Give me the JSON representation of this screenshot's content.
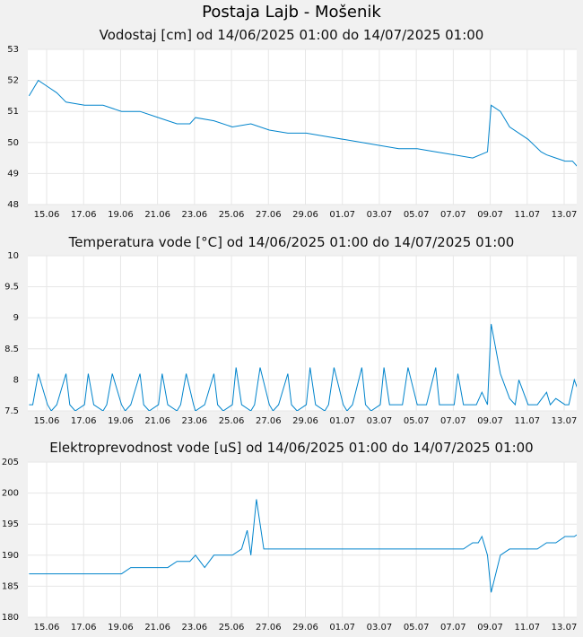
{
  "page_title": "Postaja Lajb - Mošenik",
  "line_color": "#0084cc",
  "grid_color": "#e6e6e6",
  "chart_data": [
    {
      "type": "line",
      "title": "Vodostaj [cm] od 14/06/2025 01:00 do 14/07/2025 01:00",
      "x_tick_labels": [
        "15.06",
        "17.06",
        "19.06",
        "21.06",
        "23.06",
        "25.06",
        "27.06",
        "29.06",
        "01.07",
        "03.07",
        "05.07",
        "07.07",
        "09.07",
        "11.07",
        "13.07"
      ],
      "x_range_days": [
        0,
        30
      ],
      "y_ticks": [
        48,
        49,
        50,
        51,
        52,
        53
      ],
      "ylim": [
        48,
        53
      ],
      "series": [
        {
          "x_days": [
            0.0,
            0.5,
            1.0,
            1.5,
            2.0,
            3.0,
            4.0,
            5.0,
            6.0,
            7.0,
            8.0,
            8.7,
            9.0,
            10.0,
            11.0,
            12.0,
            13.0,
            14.0,
            15.0,
            16.0,
            17.0,
            18.0,
            19.0,
            20.0,
            21.0,
            22.0,
            23.0,
            24.0,
            24.8,
            25.0,
            25.5,
            26.0,
            27.0,
            27.7,
            28.0,
            28.5,
            29.0,
            29.4,
            29.7,
            30.0
          ],
          "values": [
            51.5,
            52.0,
            51.8,
            51.6,
            51.3,
            51.2,
            51.2,
            51.0,
            51.0,
            50.8,
            50.6,
            50.6,
            50.8,
            50.7,
            50.5,
            50.6,
            50.4,
            50.3,
            50.3,
            50.2,
            50.1,
            50.0,
            49.9,
            49.8,
            49.8,
            49.7,
            49.6,
            49.5,
            49.7,
            51.2,
            51.0,
            50.5,
            50.1,
            49.7,
            49.6,
            49.5,
            49.4,
            49.4,
            49.2,
            49.0
          ]
        }
      ]
    },
    {
      "type": "line",
      "title": "Temperatura vode [°C] od 14/06/2025 01:00 do 14/07/2025 01:00",
      "x_tick_labels": [
        "15.06",
        "17.06",
        "19.06",
        "21.06",
        "23.06",
        "25.06",
        "27.06",
        "29.06",
        "01.07",
        "03.07",
        "05.07",
        "07.07",
        "09.07",
        "11.07",
        "13.07"
      ],
      "x_range_days": [
        0,
        30
      ],
      "y_ticks": [
        7.5,
        8,
        8.5,
        9,
        9.5,
        10
      ],
      "y_tick_labels": [
        "7.5",
        "8",
        "8.5",
        "9",
        "9.5",
        "10"
      ],
      "ylim": [
        7.5,
        10
      ],
      "series": [
        {
          "x_days": [
            0.0,
            0.2,
            0.5,
            1.0,
            1.2,
            1.5,
            2.0,
            2.2,
            2.5,
            3.0,
            3.2,
            3.5,
            4.0,
            4.2,
            4.5,
            5.0,
            5.2,
            5.5,
            6.0,
            6.2,
            6.5,
            7.0,
            7.2,
            7.5,
            8.0,
            8.2,
            8.5,
            8.9,
            9.0,
            9.5,
            10.0,
            10.2,
            10.5,
            11.0,
            11.2,
            11.5,
            12.0,
            12.2,
            12.5,
            13.0,
            13.2,
            13.5,
            14.0,
            14.2,
            14.5,
            15.0,
            15.2,
            15.5,
            16.0,
            16.2,
            16.5,
            17.0,
            17.2,
            17.5,
            18.0,
            18.2,
            18.5,
            19.0,
            19.2,
            19.5,
            20.0,
            20.2,
            20.5,
            21.0,
            21.2,
            21.5,
            22.0,
            22.2,
            22.5,
            23.0,
            23.2,
            23.5,
            24.0,
            24.2,
            24.5,
            24.8,
            25.0,
            25.5,
            26.0,
            26.3,
            26.5,
            27.0,
            27.2,
            27.5,
            28.0,
            28.2,
            28.5,
            29.0,
            29.2,
            29.5,
            30.0
          ],
          "values": [
            7.6,
            7.6,
            8.1,
            7.6,
            7.5,
            7.6,
            8.1,
            7.6,
            7.5,
            7.6,
            8.1,
            7.6,
            7.5,
            7.6,
            8.1,
            7.6,
            7.5,
            7.6,
            8.1,
            7.6,
            7.5,
            7.6,
            8.1,
            7.6,
            7.5,
            7.6,
            8.1,
            7.6,
            7.5,
            7.6,
            8.1,
            7.6,
            7.5,
            7.6,
            8.2,
            7.6,
            7.5,
            7.6,
            8.2,
            7.6,
            7.5,
            7.6,
            8.1,
            7.6,
            7.5,
            7.6,
            8.2,
            7.6,
            7.5,
            7.6,
            8.2,
            7.6,
            7.5,
            7.6,
            8.2,
            7.6,
            7.5,
            7.6,
            8.2,
            7.6,
            7.6,
            7.6,
            8.2,
            7.6,
            7.6,
            7.6,
            8.2,
            7.6,
            7.6,
            7.6,
            8.1,
            7.6,
            7.6,
            7.6,
            7.8,
            7.6,
            8.9,
            8.1,
            7.7,
            7.6,
            8.0,
            7.6,
            7.6,
            7.6,
            7.8,
            7.6,
            7.7,
            7.6,
            7.6,
            8.0,
            7.6
          ]
        }
      ]
    },
    {
      "type": "line",
      "title": "Elektroprevodnost vode [uS] od 14/06/2025 01:00 do 14/07/2025 01:00",
      "x_tick_labels": [
        "15.06",
        "17.06",
        "19.06",
        "21.06",
        "23.06",
        "25.06",
        "27.06",
        "29.06",
        "01.07",
        "03.07",
        "05.07",
        "07.07",
        "09.07",
        "11.07",
        "13.07"
      ],
      "x_range_days": [
        0,
        30
      ],
      "y_ticks": [
        180,
        185,
        190,
        195,
        200,
        205
      ],
      "ylim": [
        180,
        205
      ],
      "series": [
        {
          "x_days": [
            0.0,
            1.0,
            2.0,
            3.0,
            4.0,
            5.0,
            5.5,
            6.0,
            6.5,
            7.0,
            7.5,
            8.0,
            8.7,
            9.0,
            9.5,
            10.0,
            11.0,
            11.5,
            11.8,
            12.0,
            12.3,
            12.7,
            13.0,
            14.0,
            15.0,
            16.0,
            17.0,
            18.0,
            19.0,
            20.0,
            21.0,
            22.0,
            23.0,
            23.5,
            24.0,
            24.3,
            24.5,
            24.8,
            25.0,
            25.5,
            26.0,
            26.5,
            27.0,
            27.5,
            28.0,
            28.5,
            29.0,
            29.5,
            30.0
          ],
          "values": [
            187,
            187,
            187,
            187,
            187,
            187,
            188,
            188,
            188,
            188,
            188,
            189,
            189,
            190,
            188,
            190,
            190,
            191,
            194,
            190,
            199,
            191,
            191,
            191,
            191,
            191,
            191,
            191,
            191,
            191,
            191,
            191,
            191,
            191,
            192,
            192,
            193,
            190,
            184,
            190,
            191,
            191,
            191,
            191,
            192,
            192,
            193,
            193,
            194
          ]
        }
      ]
    }
  ]
}
